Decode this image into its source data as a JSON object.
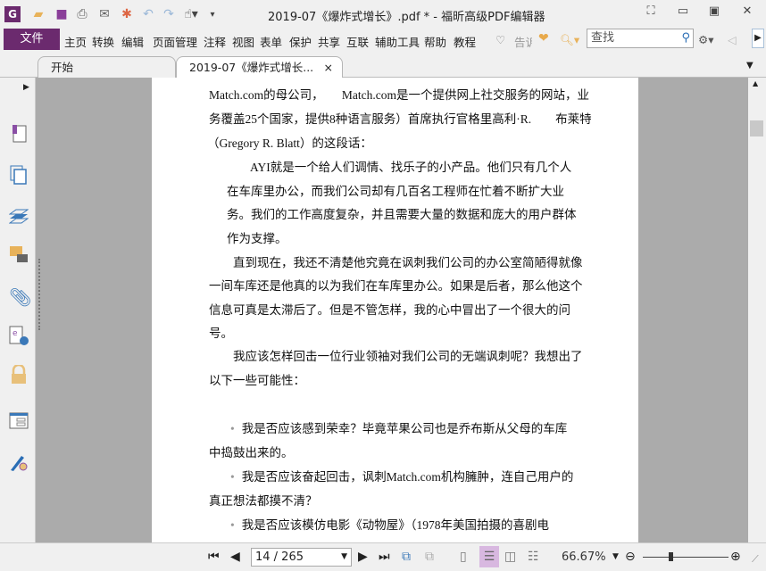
{
  "titlebar": {
    "title": "2019-07《爆炸式增长》.pdf * - 福昕高级PDF编辑器",
    "quick_access": [
      "app-logo-icon",
      "open-icon",
      "save-icon",
      "print-icon",
      "email-icon",
      "new-icon",
      "undo-icon",
      "redo-icon",
      "hand-tool-icon",
      "customize-icon"
    ]
  },
  "menu": {
    "file": "文件",
    "items": [
      "主页",
      "转换",
      "编辑",
      "页面管理",
      "注释",
      "视图",
      "表单",
      "保护",
      "共享",
      "互联",
      "辅助工具",
      "帮助",
      "教程"
    ],
    "tell_me": "告诉",
    "search_placeholder": "查找"
  },
  "tabs": [
    {
      "label": "开始"
    },
    {
      "label": "2019-07《爆炸式增长...",
      "close": "×"
    }
  ],
  "sidebar": [
    "bookmark-icon",
    "pages-icon",
    "layers-icon",
    "comments-icon",
    "attachments-icon",
    "signature-icon",
    "security-icon",
    "form-icon",
    "certify-icon"
  ],
  "document": {
    "lines": [
      "Match.com的母公司，　　Match.com是一个提供网上社交服务的网站，业",
      "务覆盖25个国家，提供8种语言服务）首席执行官格里高利·R.　　布莱特",
      "（Gregory R. Blatt）的这段话：",
      "AYI就是一个给人们调情、找乐子的小产品。他们只有几个人",
      "在车库里办公，而我们公司却有几百名工程师在忙着不断扩大业",
      "务。我们的工作高度复杂，并且需要大量的数据和庞大的用户群体",
      "作为支撑。",
      "直到现在，我还不清楚他究竟在讽刺我们公司的办公室简陋得就像",
      "一间车库还是他真的以为我们在车库里办公。如果是后者，那么他这个",
      "信息可真是太滞后了。但是不管怎样，我的心中冒出了一个很大的问",
      "号。",
      "我应该怎样回击一位行业领袖对我们公司的无端讽刺呢？我想出了",
      "以下一些可能性：",
      "我是否应该感到荣幸？毕竟苹果公司也是乔布斯从父母的车库",
      "中捣鼓出来的。",
      "我是否应该奋起回击，讽刺Match.com机构臃肿，连自己用户的",
      "真正想法都摸不清？",
      "我是否应该模仿电影《动物屋》（1978年美国拍摄的喜剧电"
    ],
    "bullet": "•"
  },
  "bottombar": {
    "page": "14 / 265",
    "zoom": "66.67%",
    "zoom_slider_fraction": 0.45
  }
}
